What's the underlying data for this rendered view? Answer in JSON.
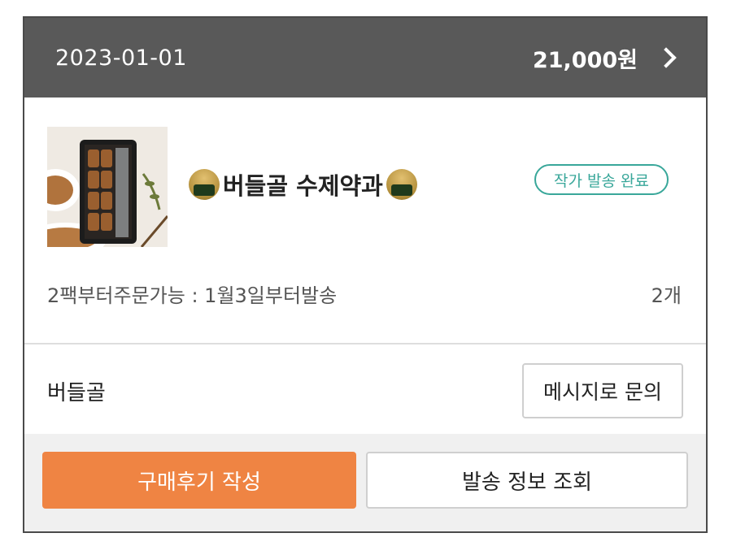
{
  "order": {
    "date": "2023-01-01",
    "total": "21,000원"
  },
  "product": {
    "name": "버들골 수제약과",
    "status_badge": "작가 발송 완료",
    "option": "2팩부터주문가능 : 1월3일부터발송",
    "quantity": "2개",
    "emoji_icon": "rice-ball-icon"
  },
  "seller": {
    "name": "버들골",
    "message_button": "메시지로 문의"
  },
  "actions": {
    "review_button": "구매후기 작성",
    "shipping_button": "발송 정보 조회"
  },
  "colors": {
    "header_bg": "#595959",
    "accent_orange": "#ef8443",
    "status_teal": "#39a79a"
  }
}
